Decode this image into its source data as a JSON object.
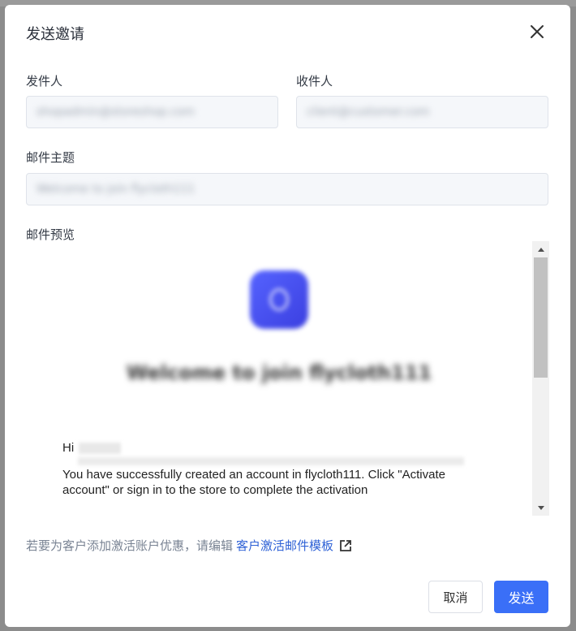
{
  "modal": {
    "title": "发送邀请"
  },
  "form": {
    "sender_label": "发件人",
    "sender_value": "shopadmin@storeshop.com",
    "recipient_label": "收件人",
    "recipient_value": "client@customer.com",
    "subject_label": "邮件主题",
    "subject_value": "Welcome to join flycloth111",
    "preview_label": "邮件预览"
  },
  "preview": {
    "welcome_heading": "Welcome to join flycloth111",
    "greeting": "Hi",
    "message": "You have successfully created an account in flycloth111. Click \"Activate account\" or sign in to the store to complete the activation"
  },
  "hint": {
    "text": "若要为客户添加激活账户优惠，请编辑",
    "link": "客户激活邮件模板"
  },
  "footer": {
    "cancel_label": "取消",
    "send_label": "发送"
  },
  "colors": {
    "primary": "#3a6ff7",
    "link": "#2f62d6"
  }
}
